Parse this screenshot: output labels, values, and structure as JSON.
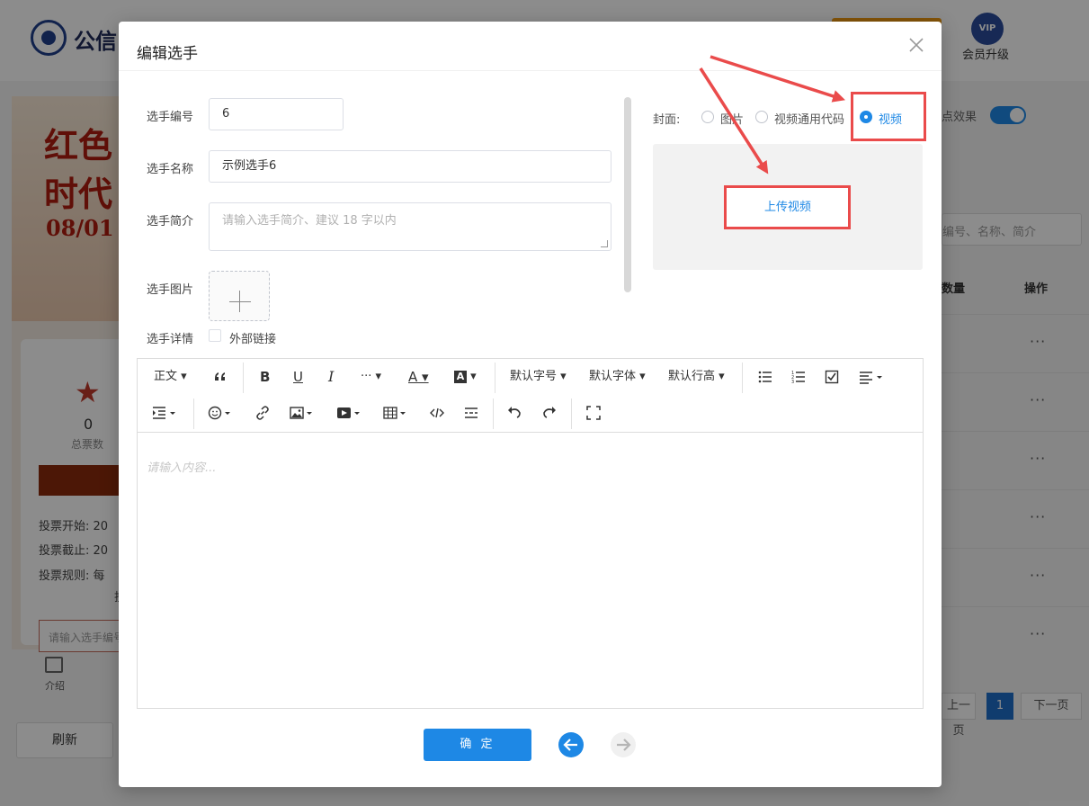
{
  "background": {
    "logo_text": "公信",
    "vip_badge": "VIP",
    "vip_label": "会员升级",
    "effect_label": "点效果",
    "search_placeholder": "编号、名称、简介",
    "col_votes": "数量",
    "col_ops": "操作",
    "pager_prev": "上一页",
    "pager_current": "1",
    "pager_next": "下一页",
    "refresh_label": "刷新",
    "intro_label": "介绍",
    "poster": {
      "line1": "红色",
      "line2": "时代",
      "date": "08/01",
      "vote_count": "0",
      "vote_count_label": "总票数",
      "vote_start": "投票开始: 20",
      "vote_end": "投票截止: 20",
      "vote_rule": "投票规则: 每",
      "vote_rule_2": "投",
      "search_placeholder": "请输入选手编号"
    }
  },
  "dialog": {
    "title": "编辑选手",
    "fields": {
      "number_label": "选手编号",
      "number_value": "6",
      "name_label": "选手名称",
      "name_value": "示例选手6",
      "intro_label": "选手简介",
      "intro_placeholder": "请输入选手简介、建议 18 字以内",
      "image_label": "选手图片",
      "detail_label": "选手详情",
      "external_link_label": "外部链接"
    },
    "cover": {
      "label": "封面:",
      "options": [
        "图片",
        "视频通用代码",
        "视频"
      ],
      "selected": "视频",
      "upload_video_label": "上传视频"
    },
    "editor": {
      "toolbar_row1": {
        "paragraph": "正文",
        "font_size": "默认字号",
        "font_family": "默认字体",
        "line_height": "默认行高",
        "more": "···"
      },
      "placeholder": "请输入内容..."
    },
    "confirm_label": "确 定"
  },
  "colors": {
    "primary": "#1e88e5",
    "annotation": "#ea4b4b"
  }
}
